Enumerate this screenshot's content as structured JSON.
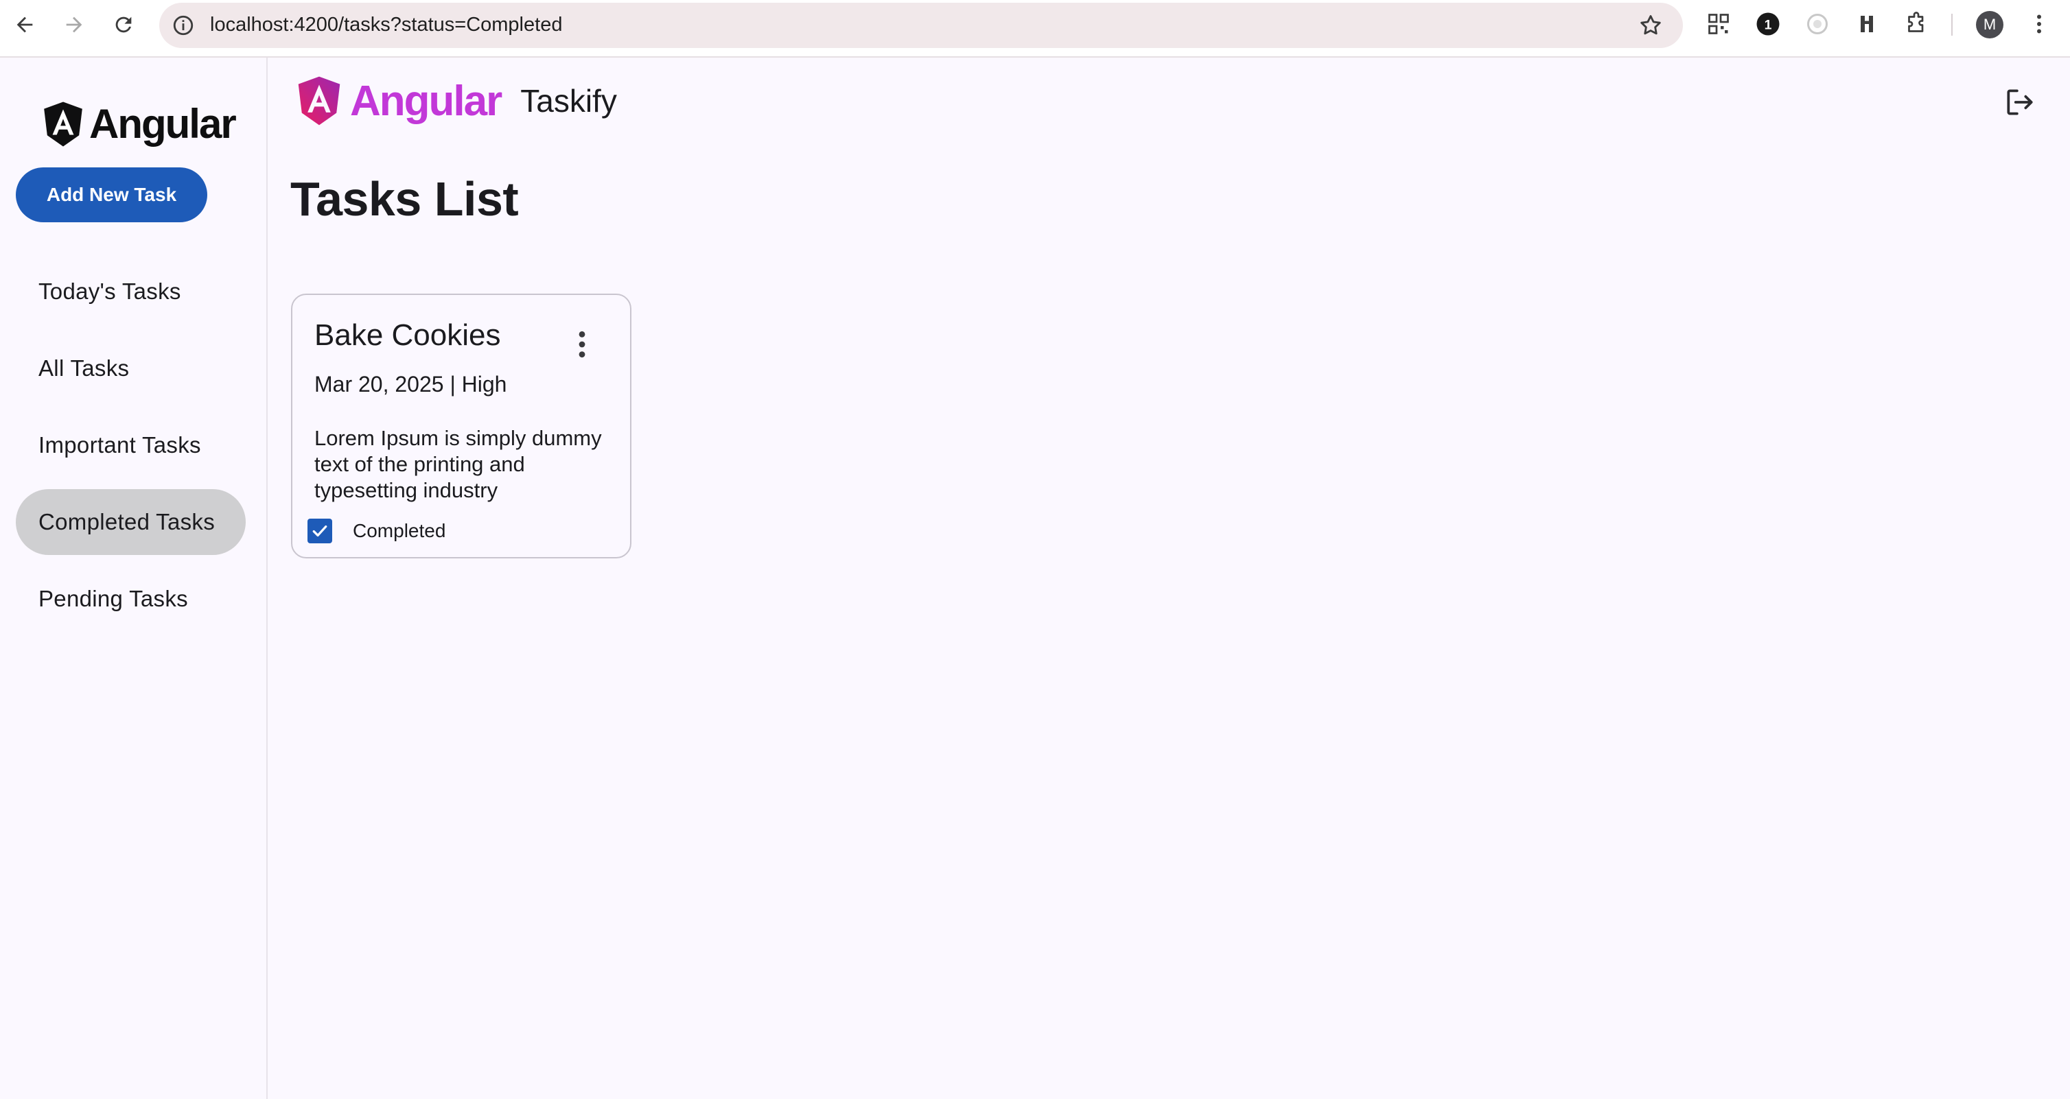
{
  "browser": {
    "url": "localhost:4200/tasks?status=Completed",
    "profile_initial": "M",
    "extension_badge": "1"
  },
  "sidebar": {
    "logo_text": "Angular",
    "add_button_label": "Add New Task",
    "items": [
      {
        "label": "Today's Tasks",
        "active": false
      },
      {
        "label": "All Tasks",
        "active": false
      },
      {
        "label": "Important Tasks",
        "active": false
      },
      {
        "label": "Completed Tasks",
        "active": true
      },
      {
        "label": "Pending Tasks",
        "active": false
      }
    ]
  },
  "header": {
    "brand_text": "Angular",
    "app_name": "Taskify",
    "logout_icon": "logout-icon"
  },
  "main": {
    "page_title": "Tasks List",
    "tasks": [
      {
        "title": "Bake Cookies",
        "meta": "Mar 20, 2025 | High",
        "description": "Lorem Ipsum is simply dummy text of the printing and typesetting industry",
        "status_label": "Completed",
        "completed": true
      }
    ]
  },
  "colors": {
    "primary": "#1e5bb8",
    "active_nav": "#cfcfd1",
    "brand_gradient_start": "#e91e63",
    "brand_gradient_end": "#9c27b0",
    "background": "#fbf8ff"
  }
}
